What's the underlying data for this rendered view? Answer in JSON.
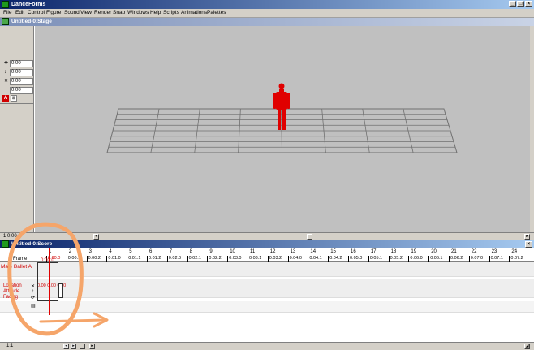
{
  "app": {
    "title": "DanceForms"
  },
  "menu": [
    "File",
    "Edit",
    "Control",
    "Figure",
    "Sound",
    "View",
    "Render",
    "Snap",
    "Windows",
    "Help",
    "Scripts",
    "Animations",
    "Palettes"
  ],
  "stage": {
    "title": "Untitled-0:Stage",
    "coords": [
      "0.00",
      "0.00",
      "0.00",
      "0.00"
    ],
    "status": "1 0:00.0"
  },
  "score": {
    "title": "Untitled-0:Score",
    "frame_label": "Frame",
    "figure_label": "Male Ballet A",
    "time_value": "0:00.0",
    "track_labels": [
      "Location",
      "Attitude",
      "Facing"
    ],
    "key_value": "0.00 0.00 0.00",
    "frame_numbers": [
      "1",
      "2",
      "3",
      "4",
      "5",
      "6",
      "7",
      "8",
      "9",
      "10",
      "11",
      "12",
      "13",
      "14",
      "15",
      "16",
      "17",
      "18",
      "19",
      "20",
      "21",
      "22",
      "23",
      "24"
    ],
    "time_labels": [
      "0:00.0",
      "0:00.1",
      "0:00.2",
      "0:01.0",
      "0:01.1",
      "0:01.2",
      "0:02.0",
      "0:02.1",
      "0:02.2",
      "0:03.0",
      "0:03.1",
      "0:03.2",
      "0:04.0",
      "0:04.1",
      "0:04.2",
      "0:05.0",
      "0:05.1",
      "0:05.2",
      "0:06.0",
      "0:06.1",
      "0:06.2",
      "0:07.0",
      "0:07.1",
      "0:07.2"
    ],
    "status": "1:1"
  },
  "colors": {
    "figure": "#e00000",
    "annotation": "#f5a56a"
  }
}
